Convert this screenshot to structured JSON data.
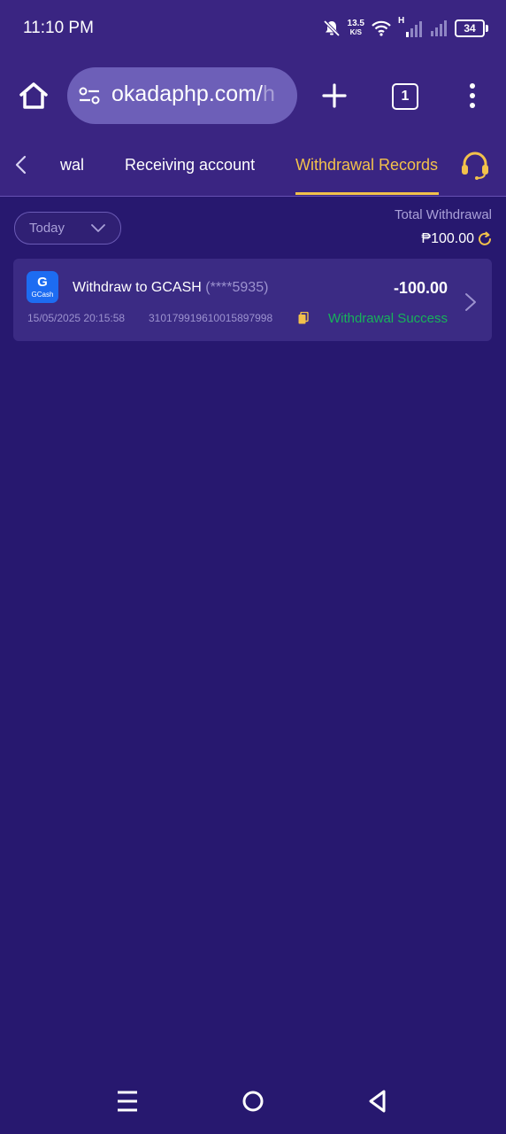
{
  "status_bar": {
    "time": "11:10 PM",
    "net_speed_value": "13.5",
    "net_speed_unit": "K/S",
    "network_type": "H",
    "battery": "34"
  },
  "browser": {
    "url_main": "okadaphp.com/",
    "url_dim": "h",
    "tab_count": "1"
  },
  "nav_tabs": [
    {
      "label": "wal"
    },
    {
      "label": "Receiving account"
    },
    {
      "label": "Withdrawal Records",
      "active": true
    }
  ],
  "filter": {
    "selected": "Today"
  },
  "summary": {
    "label": "Total Withdrawal",
    "amount": "₱100.00"
  },
  "records": [
    {
      "title": "Withdraw to GCASH",
      "masked_account": "(****5935)",
      "amount": "-100.00",
      "datetime": "15/05/2025 20:15:58",
      "order_id": "310179919610015897998",
      "status": "Withdrawal Success",
      "logo_letter": "G",
      "logo_text": "GCash"
    }
  ],
  "colors": {
    "background": "#27186f",
    "header": "#3a2582",
    "accent": "#f2c14b",
    "success": "#17b25a",
    "card": "#3b2b84"
  },
  "icons": [
    "home-icon",
    "tune-icon",
    "plus-icon",
    "tabs-icon",
    "more-vert-icon",
    "chevron-left-icon",
    "headset-icon",
    "chevron-down-icon",
    "refresh-icon",
    "copy-icon",
    "chevron-right-icon",
    "menu-icon",
    "home-circle-icon",
    "back-triangle-icon"
  ]
}
